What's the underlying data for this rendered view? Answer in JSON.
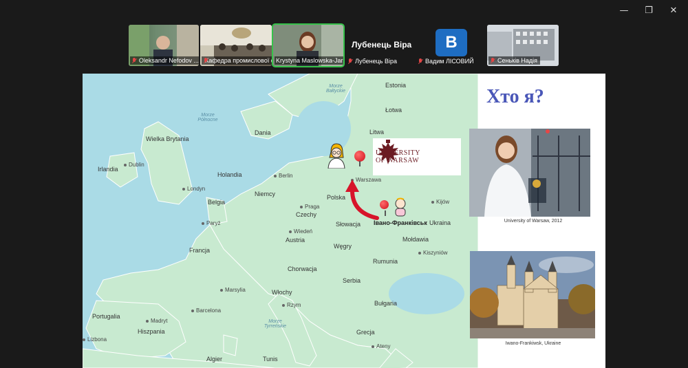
{
  "window": {
    "controls": [
      "—",
      "❐",
      "✕"
    ]
  },
  "participants": [
    {
      "name": "Oleksandr Nefodov ..."
    },
    {
      "name": "Кафедра промислової фа..."
    },
    {
      "name": "Krystyna Maslowska-Jarzy..."
    },
    {
      "name": "Лубенець Віра",
      "display_name": "Лубенець Віра"
    },
    {
      "name": "Вадим ЛІСОВИЙ",
      "avatar_letter": "B"
    },
    {
      "name": "Сеньків Надія"
    }
  ],
  "slide": {
    "title": "Хто я?",
    "map": {
      "countries": [
        "Estonia",
        "Łotwa",
        "Litwa",
        "Dania",
        "Wielka Brytania",
        "Irlandia",
        "Holandia",
        "Niemcy",
        "Belgia",
        "Polska",
        "Czechy",
        "Słowacja",
        "Ukraina",
        "Mołdawia",
        "Austria",
        "Węgry",
        "Rumunia",
        "Francja",
        "Chorwacja",
        "Serbia",
        "Bułgaria",
        "Włochy",
        "Hiszpania",
        "Portugalia",
        "Grecja",
        "Algier",
        "Tunis"
      ],
      "cities": [
        "Dublin",
        "Londyn",
        "Paryż",
        "Berlin",
        "Warszawa",
        "Praga",
        "Wiedeń",
        "Kijów",
        "Kiszyniów",
        "Madryt",
        "Barcelona",
        "Marsylia",
        "Rzym",
        "Lizbona",
        "Ateny"
      ],
      "seas": [
        "Morze Północne",
        "Morze Bałtyckie",
        "Morze Tyrreńskie"
      ],
      "highlighted_city": "Івано-Франківськ",
      "logo_line1": "University",
      "logo_line2": "of Warsaw"
    },
    "photo1_caption": "University of Warsaw, 2012",
    "photo2_caption": "Iwano-Frankiwsk, Ukraine"
  }
}
